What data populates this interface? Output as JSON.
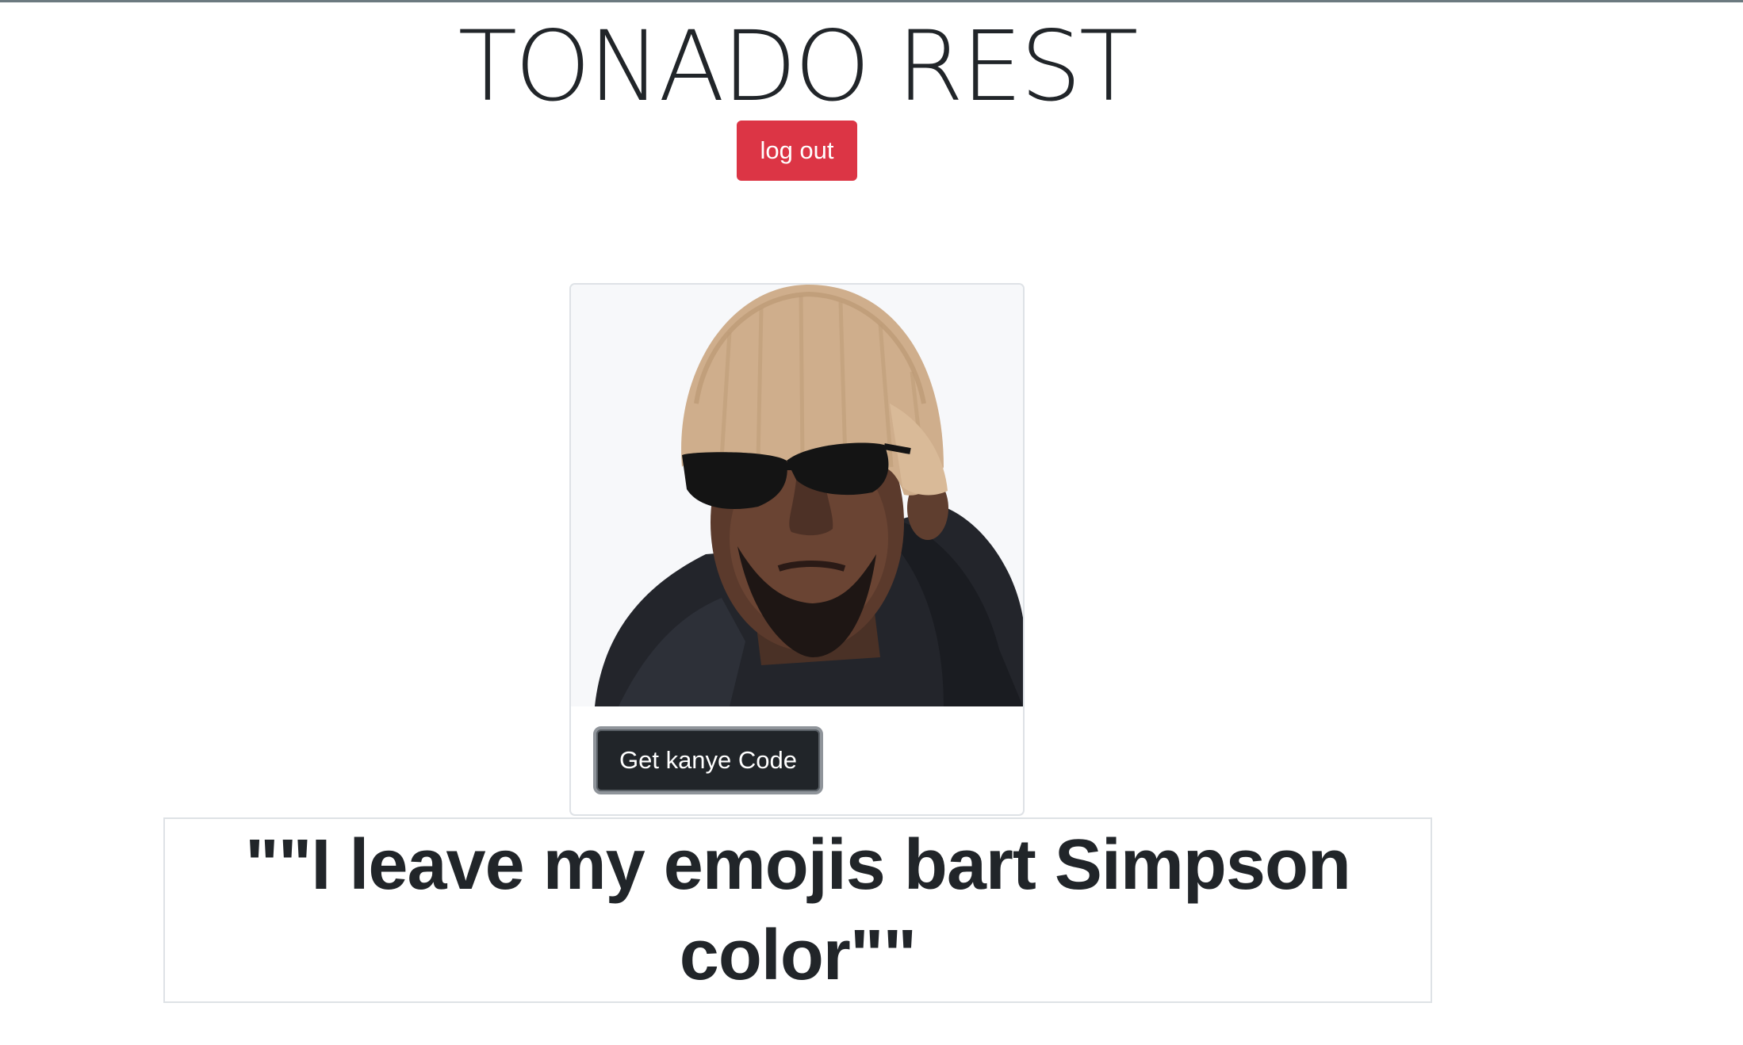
{
  "header": {
    "title": "TONADO REST",
    "logout_label": "log out"
  },
  "card": {
    "image_subject": "kanye-photo",
    "button_label": "Get kanye Code"
  },
  "quote": {
    "text": "\"\"I leave my emojis bart Simpson color\"\""
  },
  "colors": {
    "danger": "#dc3545",
    "dark": "#212529",
    "border": "#dee2e6",
    "text": "#212529"
  }
}
